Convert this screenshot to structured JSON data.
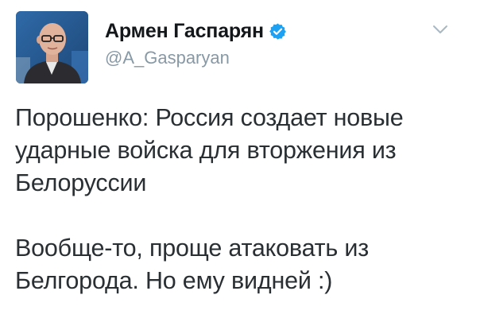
{
  "tweet": {
    "author": {
      "display_name": "Армен Гаспарян",
      "handle": "@A_Gasparyan",
      "verified": true
    },
    "paragraphs": [
      "Порошенко: Россия создает новые\nударные войска для вторжения из\nБелоруссии",
      "Вообще-то, проще атаковать из\nБелгорода. Но ему видней :)"
    ]
  },
  "icons": {
    "verified": "verified-badge-icon",
    "caret": "chevron-down-icon"
  },
  "colors": {
    "text": "#292f33",
    "name": "#14171a",
    "handle": "#8899a6",
    "verified_badge": "#1da1f2",
    "caret": "#aab8c2"
  }
}
